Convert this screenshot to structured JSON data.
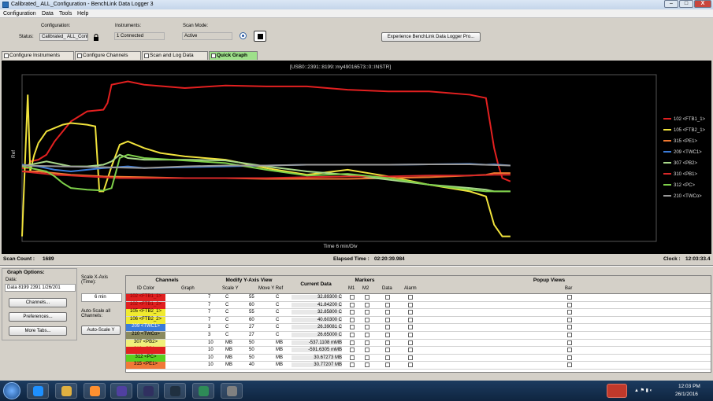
{
  "window": {
    "title": "Calibrated_ ALL_Configuration - BenchLink Data Logger 3",
    "controls": [
      "–",
      "□",
      "X"
    ]
  },
  "menu": [
    "Configuration",
    "Data",
    "Tools",
    "Help"
  ],
  "toolbar": {
    "configuration_label": "Configuration:",
    "status_label": "Status:",
    "configuration_value": "Calibrated_ ALL_Confi",
    "instruments_label": "Instruments:",
    "instruments_value": "1 Connected",
    "scan_mode_label": "Scan Mode:",
    "scan_mode_value": "Active",
    "pro_button": "Experience BenchLink Data Logger Pro..."
  },
  "tabs": [
    {
      "label": "Configure Instruments",
      "active": false
    },
    {
      "label": "Configure Channels",
      "active": false
    },
    {
      "label": "Scan and Log Data",
      "active": false
    },
    {
      "label": "Quick Graph",
      "active": true
    }
  ],
  "chart": {
    "header": "[USB0::2391::8199::my49016573::0::INSTR]",
    "ylabel": "Ref",
    "xlabel": "Time 6 min/Div"
  },
  "chart_data": {
    "type": "line",
    "title": "[USB0::2391::8199::my49016573::0::INSTR]",
    "xlabel": "Time 6 min/Div",
    "ylabel": "Ref",
    "xlim": [
      0,
      60
    ],
    "ylim": [
      0,
      10
    ],
    "grid": false,
    "legend": "right",
    "series": [
      {
        "name": "102 <FTB1_1>",
        "color": "#e32020",
        "x": [
          0,
          0.7,
          1,
          2,
          3,
          4,
          6,
          8,
          10,
          10.5,
          11,
          13,
          15,
          20,
          25,
          30,
          35,
          40,
          45,
          50,
          55,
          57,
          58,
          58.5,
          59,
          60
        ],
        "y": [
          4.4,
          4.4,
          4.8,
          4.9,
          5.2,
          6.0,
          7.2,
          7.8,
          7.9,
          8.3,
          9.4,
          9.6,
          9.4,
          9.2,
          9.35,
          9.3,
          9.3,
          9.1,
          9.0,
          9.0,
          8.8,
          8.6,
          5.6,
          4.6,
          3.8,
          3.6
        ]
      },
      {
        "name": "105 <FTB2_1>",
        "color": "#f0e23c",
        "x": [
          0,
          0.7,
          1,
          1.5,
          2,
          3,
          4,
          5,
          6,
          7,
          8,
          9,
          9.5,
          10,
          11,
          12,
          13,
          15,
          17,
          20,
          25,
          30,
          35,
          40,
          45,
          50,
          55,
          57,
          58,
          59,
          60
        ],
        "y": [
          0.3,
          8.8,
          4.2,
          5.2,
          5.9,
          6.6,
          6.8,
          7.0,
          7.1,
          7.05,
          7.0,
          6.9,
          3.0,
          3.0,
          4.5,
          5.8,
          6.0,
          5.6,
          5.3,
          5.1,
          4.9,
          4.4,
          4.0,
          4.3,
          3.9,
          3.4,
          3.0,
          2.7,
          1.0,
          0.3,
          0.3
        ]
      },
      {
        "name": "315 <PE1>",
        "color": "#f07830",
        "x": [
          0,
          2,
          4,
          6,
          10,
          15,
          20,
          25,
          30,
          35,
          40,
          45,
          50,
          55,
          57,
          58,
          59,
          60
        ],
        "y": [
          4.2,
          4.2,
          4.1,
          4.0,
          3.9,
          3.85,
          3.8,
          3.8,
          3.75,
          3.75,
          3.75,
          3.8,
          3.85,
          3.95,
          4.0,
          4.1,
          4.1,
          4.1
        ]
      },
      {
        "name": "209 <TWC1>",
        "color": "#3b7bd8",
        "x": [
          0,
          2,
          4,
          6,
          8,
          10,
          13,
          15,
          20,
          25,
          30,
          35,
          40,
          45,
          50,
          55,
          57,
          58,
          60
        ],
        "y": [
          4.6,
          4.5,
          4.3,
          4.2,
          4.3,
          4.4,
          4.5,
          4.4,
          4.45,
          4.5,
          4.55,
          4.6,
          4.6,
          4.6,
          4.62,
          4.65,
          4.6,
          4.62,
          4.55
        ]
      },
      {
        "name": "307 <PB2>",
        "color": "#a8d88a",
        "x": [
          0,
          1,
          2,
          3,
          4,
          5,
          6,
          8,
          10,
          11,
          12,
          13,
          15,
          20,
          25,
          30,
          35,
          40,
          45,
          50,
          55,
          57,
          58,
          60
        ],
        "y": [
          4.5,
          4.6,
          4.7,
          4.8,
          4.7,
          4.6,
          4.5,
          4.5,
          4.6,
          4.8,
          5.2,
          5.0,
          4.9,
          4.9,
          4.85,
          4.5,
          4.2,
          4.0,
          3.7,
          3.4,
          3.2,
          3.1,
          3.0,
          3.0
        ]
      },
      {
        "name": "310 <PB1>",
        "color": "#d82828",
        "x": [
          0,
          2,
          4,
          6,
          8,
          10,
          12,
          15,
          20,
          25,
          30,
          35,
          40,
          45,
          50,
          55,
          58,
          60
        ],
        "y": [
          4.2,
          4.1,
          4.0,
          3.95,
          3.9,
          3.85,
          3.8,
          3.8,
          3.8,
          3.8,
          3.8,
          3.85,
          3.9,
          3.9,
          3.95,
          3.95,
          4.0,
          4.0
        ]
      },
      {
        "name": "312 <PC>",
        "color": "#7ed04a",
        "x": [
          0,
          1,
          2,
          3,
          4,
          5,
          6,
          8,
          10,
          11,
          12,
          13,
          15,
          20,
          25,
          30,
          35,
          40,
          45,
          50,
          55,
          57,
          58,
          60
        ],
        "y": [
          4.5,
          4.4,
          4.3,
          4.2,
          3.9,
          3.5,
          3.2,
          3.1,
          3.05,
          3.2,
          5.0,
          5.2,
          5.0,
          4.85,
          4.7,
          4.3,
          3.95,
          4.05,
          3.8,
          3.4,
          3.1,
          3.0,
          3.0,
          3.0
        ]
      },
      {
        "name": "210 <TWCo>",
        "color": "#9a9a9a",
        "x": [
          0,
          5,
          10,
          15,
          20,
          25,
          30,
          35,
          40,
          45,
          50,
          55,
          58,
          60
        ],
        "y": [
          4.55,
          4.5,
          4.45,
          4.4,
          4.5,
          4.55,
          4.55,
          4.6,
          4.6,
          4.6,
          4.62,
          4.62,
          4.58,
          4.55
        ]
      }
    ]
  },
  "status": {
    "scan_count_label": "Scan Count :",
    "scan_count": "1689",
    "elapsed_label": "Elapsed Time :",
    "elapsed": "02:20:39.984",
    "clock_label": "Clock :",
    "clock": "12:03:33.4"
  },
  "graph_options": {
    "title": "Graph Options:",
    "data_label": "Data:",
    "data_value": "Data 8199 2391 1/26/201",
    "channels_btn": "Channels...",
    "preferences_btn": "Preferences...",
    "more_tabs_btn": "More Tabs...",
    "scale_x_label": "Scale X-Axis (Time):",
    "scale_x_value": "6 min",
    "autoscale_all": "Auto-Scale all Channels:",
    "autoscale_y": "Auto-Scale Y"
  },
  "grid": {
    "channels_hdr": "Channels",
    "modify_hdr": "Modify Y-Axis View",
    "current_hdr": "Current Data",
    "markers_hdr": "Markers",
    "popup_hdr": "Popup Views",
    "col_id": "ID Color",
    "col_graph": "Graph",
    "col_scale": "Scale Y",
    "col_move": "Move Y Ref",
    "col_m1": "M1",
    "col_m2": "M2",
    "col_data": "Data",
    "col_alarm": "Alarm",
    "col_bar": "Bar",
    "rows": [
      {
        "id": "102 <FTB1_1>",
        "color": "#e02020",
        "text": "#800000",
        "scale": "7",
        "unit": "C",
        "ref": "55",
        "refunit": "C",
        "current": "32.89300 C"
      },
      {
        "id": "102 <FTB1_2>",
        "color": "#e02020",
        "text": "#800000",
        "scale": "7",
        "unit": "C",
        "ref": "60",
        "refunit": "C",
        "current": "41.84200 C"
      },
      {
        "id": "105 <FTB2_1>",
        "color": "#f0ea30",
        "text": "#000000",
        "scale": "7",
        "unit": "C",
        "ref": "55",
        "refunit": "C",
        "current": "32.85800 C"
      },
      {
        "id": "106 <FTB2_2>",
        "color": "#f0ea30",
        "text": "#000000",
        "scale": "7",
        "unit": "C",
        "ref": "60",
        "refunit": "C",
        "current": "40.60300 C"
      },
      {
        "id": "209 <TWC1>",
        "color": "#3b7bd8",
        "text": "#ffffff",
        "scale": "3",
        "unit": "C",
        "ref": "27",
        "refunit": "C",
        "current": "26.39081 C"
      },
      {
        "id": "210 <TWCo>",
        "color": "#8a8a60",
        "text": "#000000",
        "scale": "3",
        "unit": "C",
        "ref": "27",
        "refunit": "C",
        "current": "26.65000 C"
      },
      {
        "id": "307 <PB2>",
        "color": "#f0f07a",
        "text": "#000000",
        "scale": "10",
        "unit": "MB",
        "ref": "50",
        "refunit": "MB",
        "current": "-537.1108 mMB"
      },
      {
        "id": "310 <PB1>",
        "color": "#e02020",
        "text": "#e02020",
        "scale": "10",
        "unit": "MB",
        "ref": "50",
        "refunit": "MB",
        "current": "-591.6305 mMB"
      },
      {
        "id": "312 <PC>",
        "color": "#58d020",
        "text": "#000000",
        "scale": "10",
        "unit": "MB",
        "ref": "50",
        "refunit": "MB",
        "current": "30.67273 MB"
      },
      {
        "id": "315 <PE1>",
        "color": "#f07838",
        "text": "#000000",
        "scale": "10",
        "unit": "MB",
        "ref": "40",
        "refunit": "MB",
        "current": "30.77207 MB"
      }
    ]
  },
  "taskbar": {
    "time": "12:03 PM",
    "date": "26/1/2016",
    "apps": [
      "ie-icon",
      "explorer-icon",
      "media-player-icon",
      "benchlink-icon",
      "app-icon",
      "scope-icon",
      "excel-icon",
      "settings-icon"
    ]
  }
}
